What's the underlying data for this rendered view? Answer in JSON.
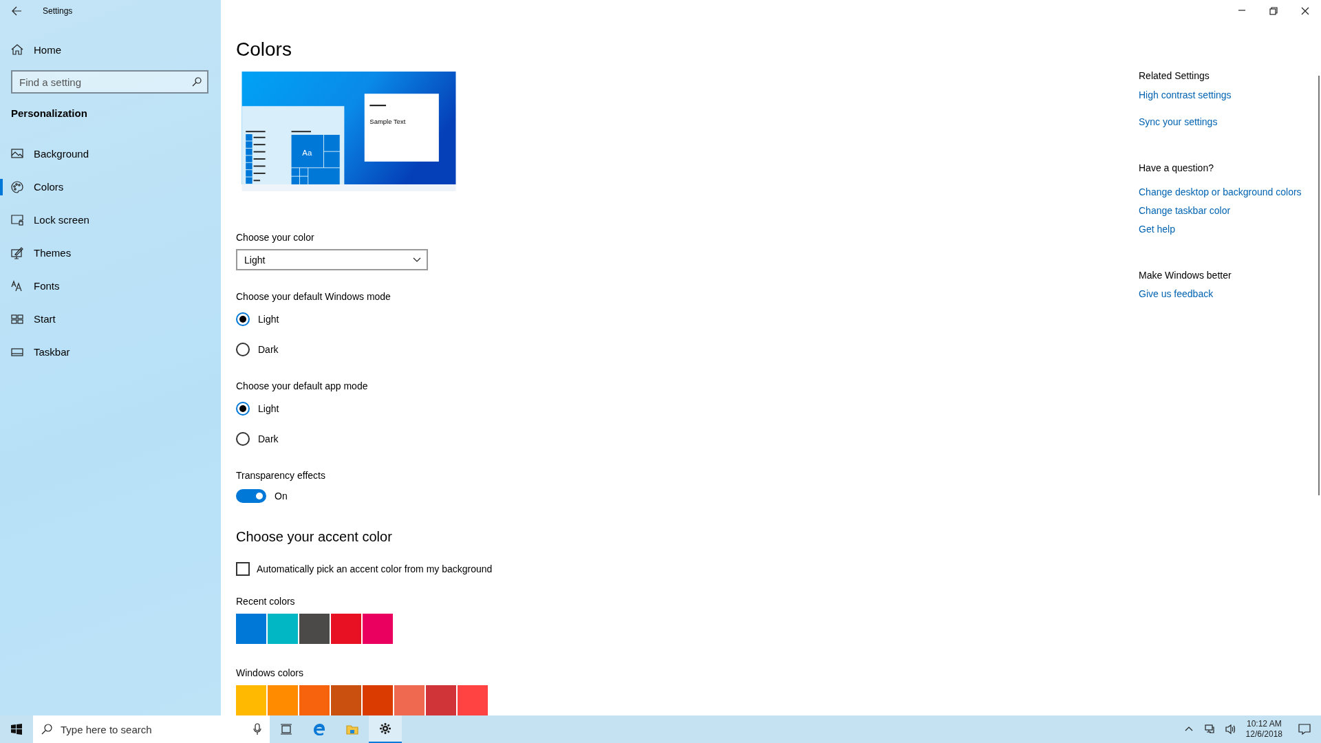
{
  "window": {
    "title": "Settings"
  },
  "sidebar": {
    "home": "Home",
    "search": {
      "placeholder": "Find a setting"
    },
    "section": "Personalization",
    "items": [
      {
        "label": "Background",
        "kind": "background",
        "selected": false
      },
      {
        "label": "Colors",
        "kind": "colors",
        "selected": true
      },
      {
        "label": "Lock screen",
        "kind": "lock",
        "selected": false
      },
      {
        "label": "Themes",
        "kind": "themes",
        "selected": false
      },
      {
        "label": "Fonts",
        "kind": "fonts",
        "selected": false
      },
      {
        "label": "Start",
        "kind": "start",
        "selected": false
      },
      {
        "label": "Taskbar",
        "kind": "taskbar",
        "selected": false
      }
    ]
  },
  "page": {
    "title": "Colors",
    "preview": {
      "tile_text": "Aa",
      "sample_text": "Sample Text"
    },
    "color_choice": {
      "label": "Choose your color",
      "value": "Light"
    },
    "radio_groups": [
      {
        "label": "Choose your default Windows mode",
        "options": [
          {
            "label": "Light",
            "selected": true
          },
          {
            "label": "Dark",
            "selected": false
          }
        ]
      },
      {
        "label": "Choose your default app mode",
        "options": [
          {
            "label": "Light",
            "selected": true
          },
          {
            "label": "Dark",
            "selected": false
          }
        ]
      }
    ],
    "transparency": {
      "label": "Transparency effects",
      "on": true,
      "state_text": "On"
    },
    "accent_heading": "Choose your accent color",
    "auto_pick": {
      "label": "Automatically pick an accent color from my background",
      "checked": false
    },
    "palettes": [
      {
        "label": "Recent colors",
        "swatches": [
          {
            "color": "#0078d7"
          },
          {
            "color": "#00b7c3"
          },
          {
            "color": "#4c4a48"
          },
          {
            "color": "#e81123"
          },
          {
            "color": "#ea005e"
          }
        ]
      },
      {
        "label": "Windows colors",
        "swatches": [
          {
            "color": "#ffb900"
          },
          {
            "color": "#ff8c00"
          },
          {
            "color": "#f7630c"
          },
          {
            "color": "#ca5010"
          },
          {
            "color": "#da3b01"
          },
          {
            "color": "#ef6950"
          },
          {
            "color": "#d13438"
          },
          {
            "color": "#ff4343"
          }
        ]
      }
    ]
  },
  "related": [
    {
      "heading": "Related Settings",
      "links": [
        "High contrast settings",
        "Sync your settings"
      ]
    },
    {
      "heading": "Have a question?",
      "links": [
        "Change desktop or background colors",
        "Change taskbar color",
        "Get help"
      ]
    },
    {
      "heading": "Make Windows better",
      "links": [
        "Give us feedback"
      ]
    }
  ],
  "taskbar": {
    "search": {
      "placeholder": "Type here to search"
    },
    "apps": [
      {
        "kind": "taskview",
        "selected": false
      },
      {
        "kind": "edge",
        "selected": false
      },
      {
        "kind": "explorer",
        "selected": false
      },
      {
        "kind": "settings",
        "selected": true
      }
    ],
    "time": "10:12 AM",
    "date": "12/6/2018"
  }
}
